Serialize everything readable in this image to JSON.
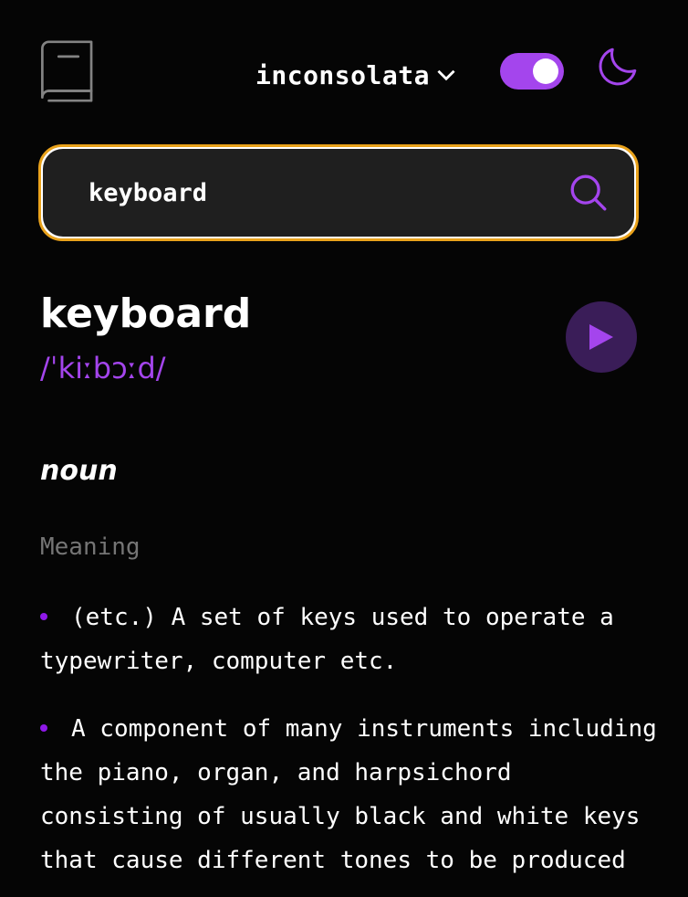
{
  "header": {
    "font_label": "inconsolata",
    "toggle_on": true,
    "accent": "#a445ed"
  },
  "search": {
    "value": "keyboard",
    "border_color": "#e9a21b"
  },
  "entry": {
    "word": "keyboard",
    "phonetic": "/ˈkiːbɔːd/",
    "part_of_speech": "noun",
    "meaning_label": "Meaning",
    "definitions": [
      "(etc.) A set of keys used to operate a typewriter, computer etc.",
      "A component of many instruments including the piano, organ, and harpsichord consisting of usually black and white keys that cause different tones to be produced"
    ]
  }
}
